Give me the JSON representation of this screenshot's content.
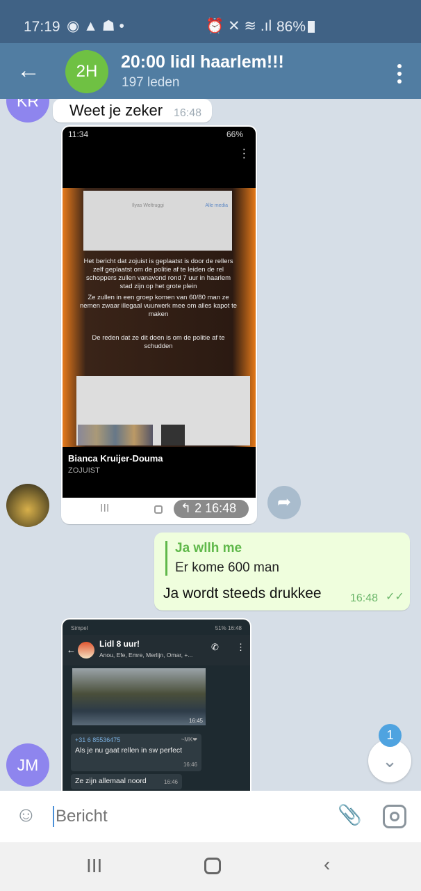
{
  "status_bar": {
    "time": "17:19",
    "battery": "86%"
  },
  "header": {
    "avatar_initials": "2H",
    "title": "20:00 lidl haarlem!!!",
    "subtitle": "197 leden",
    "avatar_color": "#6fc143"
  },
  "messages": [
    {
      "type": "text",
      "sender_initials": "KR",
      "text": "Weet je zeker",
      "time": "16:48"
    },
    {
      "type": "photo",
      "time": "16:48",
      "replies": "2",
      "screenshot": {
        "status_time": "11:34",
        "battery": "66%",
        "header_name": "Ilyas Weltruggi",
        "link": "Alle media",
        "body": [
          "Het bericht dat zojuist is geplaatst is door de rellers zelf geplaatst om de politie af te leiden de rel schoppers zullen vanavond rond 7 uur in haarlem stad zijn op het grote plein",
          "Ze zullen in een groep komen van 60/80 man ze nemen zwaar illegaal vuurwerk mee om alles kapot te maken",
          "De reden dat ze dit doen is om de politie af te schudden"
        ],
        "author": "Bianca Kruijer-Douma",
        "author_sub": "ZOJUIST"
      }
    },
    {
      "type": "outgoing",
      "reply_name": "Ja wllh me",
      "reply_text": "Er kome 600 man",
      "text": "Ja wordt steeds drukkee",
      "time": "16:48"
    },
    {
      "type": "photo",
      "sender_initials": "JM",
      "screenshot": {
        "carrier": "Simpel",
        "battery_time": "51% 16:48",
        "chat_title": "Lidl 8 uur!",
        "members": "Anou, Efe, Emre, Merlijn, Omar, +...",
        "img_time": "16:45",
        "msg1_sender": "+31 6 85536475",
        "msg1_tag": "~MK❤",
        "msg1_text": "Als je nu gaat rellen in sw perfect",
        "msg1_time": "16:46",
        "msg2_text": "Ze zijn allemaal noord",
        "msg2_time": "16:46"
      }
    }
  ],
  "scroll_badge": "1",
  "input": {
    "placeholder": "Bericht"
  }
}
